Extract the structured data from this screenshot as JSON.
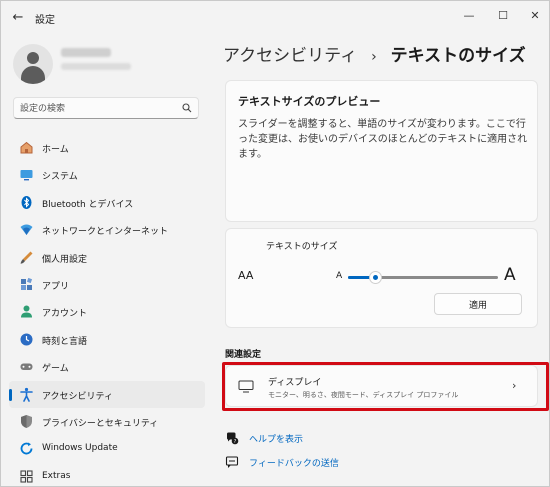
{
  "window": {
    "title": "設定",
    "back_glyph": "←",
    "minimize_glyph": "—",
    "maximize_glyph": "☐",
    "close_glyph": "✕"
  },
  "profile": {
    "avatar_icon": "user-avatar-icon"
  },
  "search": {
    "placeholder": "設定の検索",
    "icon": "search-icon"
  },
  "sidebar": {
    "items": [
      {
        "label": "ホーム",
        "icon": "home-icon",
        "color": "#c86b3c"
      },
      {
        "label": "システム",
        "icon": "system-icon",
        "color": "#0078d4"
      },
      {
        "label": "Bluetooth とデバイス",
        "icon": "bluetooth-icon",
        "color": "#0067c0"
      },
      {
        "label": "ネットワークとインターネット",
        "icon": "network-icon",
        "color": "#2a8cd6"
      },
      {
        "label": "個人用設定",
        "icon": "personalization-icon",
        "color": "#d58b3b"
      },
      {
        "label": "アプリ",
        "icon": "apps-icon",
        "color": "#4a7ab8"
      },
      {
        "label": "アカウント",
        "icon": "account-icon",
        "color": "#2f9e73"
      },
      {
        "label": "時刻と言語",
        "icon": "time-language-icon",
        "color": "#2b6cc4"
      },
      {
        "label": "ゲーム",
        "icon": "gaming-icon",
        "color": "#6a6a6a"
      },
      {
        "label": "アクセシビリティ",
        "icon": "accessibility-icon",
        "color": "#1a6fd1",
        "active": true
      },
      {
        "label": "プライバシーとセキュリティ",
        "icon": "privacy-shield-icon",
        "color": "#6a6a6a"
      },
      {
        "label": "Windows Update",
        "icon": "windows-update-icon",
        "color": "#0078d4"
      },
      {
        "label": "Extras",
        "icon": "extras-icon",
        "color": "#444444"
      }
    ]
  },
  "breadcrumb": {
    "parent": "アクセシビリティ",
    "separator": "›",
    "current": "テキストのサイズ"
  },
  "preview": {
    "title": "テキストサイズのプレビュー",
    "text": "スライダーを調整すると、単語のサイズが変わります。ここで行った変更は、お使いのデバイスのほとんどのテキストに適用されます。"
  },
  "text_size": {
    "label": "テキストのサイズ",
    "aa_label": "AA",
    "small_a": "A",
    "big_a": "A",
    "value_fraction": 0.18,
    "apply_label": "適用"
  },
  "related": {
    "heading": "関連設定",
    "display": {
      "title": "ディスプレイ",
      "description": "モニター、明るさ、夜間モード、ディスプレイ プロファイル",
      "chevron": "›",
      "icon": "monitor-icon"
    }
  },
  "links": {
    "help": "ヘルプを表示",
    "feedback": "フィードバックの送信"
  },
  "colors": {
    "accent": "#0067c0",
    "highlight": "#d10a14"
  }
}
